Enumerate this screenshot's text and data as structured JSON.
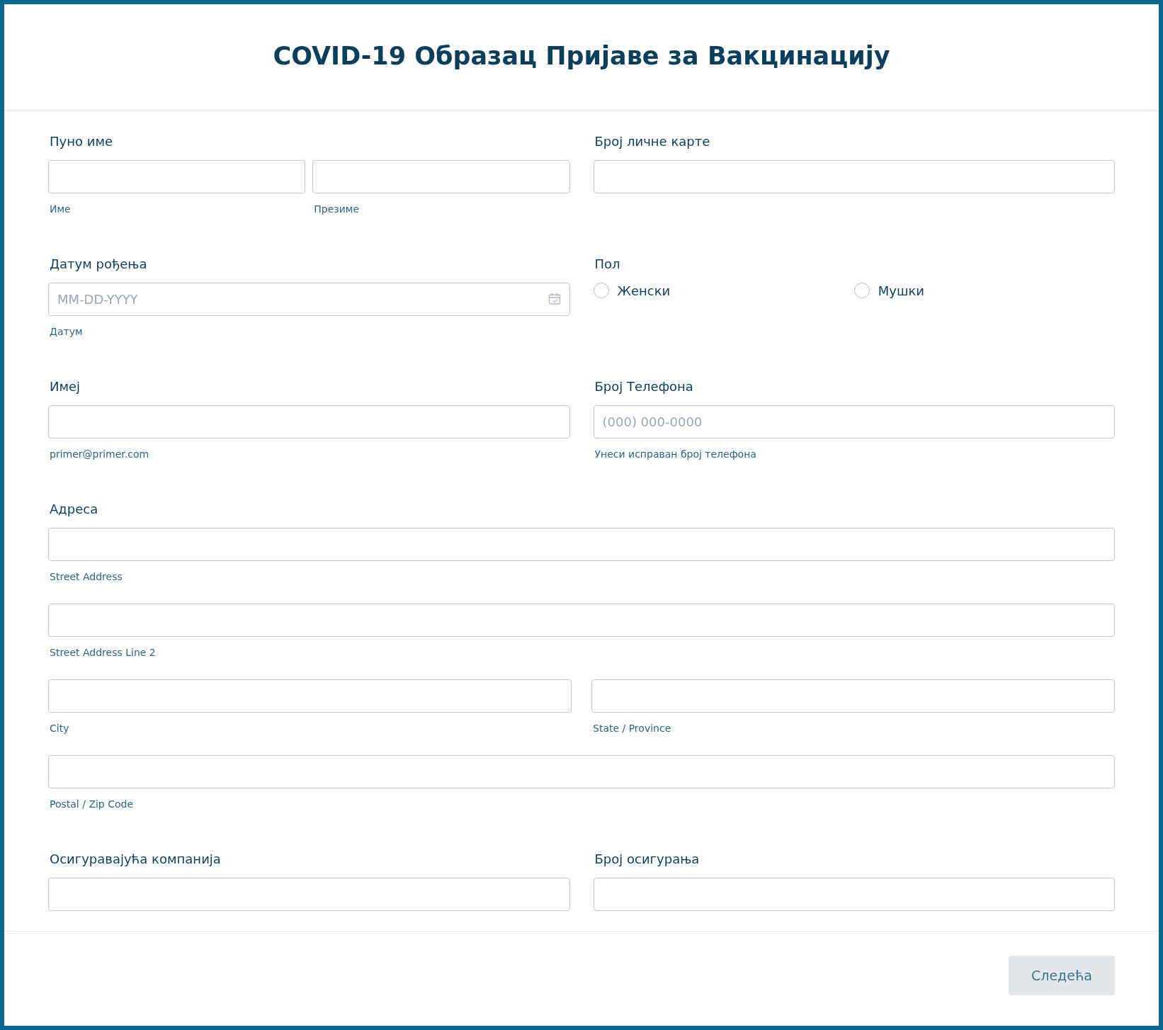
{
  "title": "COVID-19 Образац Пријаве за Вакцинацију",
  "rows": [
    {
      "fields": [
        {
          "kind": "input",
          "label": "Пуно име",
          "lines": [
            [
              {
                "kind": "text",
                "sublabel": "Име"
              },
              {
                "kind": "text",
                "sublabel": "Презиме"
              }
            ]
          ]
        },
        {
          "kind": "input",
          "label": "Број личне карте",
          "lines": [
            [
              {
                "kind": "text"
              }
            ]
          ]
        }
      ]
    },
    {
      "fields": [
        {
          "kind": "input",
          "label": "Датум рођења",
          "lines": [
            [
              {
                "kind": "date",
                "placeholder": "MM-DD-YYYY",
                "sublabel": "Датум"
              }
            ]
          ]
        },
        {
          "kind": "radio",
          "label": "Пол",
          "options": [
            {
              "label": "Женски",
              "selected": false
            },
            {
              "label": "Мушки",
              "selected": false
            }
          ]
        }
      ]
    },
    {
      "fields": [
        {
          "kind": "input",
          "label": "Имеј",
          "lines": [
            [
              {
                "kind": "text",
                "sublabel": "primer@primer.com"
              }
            ]
          ]
        },
        {
          "kind": "input",
          "label": "Број Телефона",
          "lines": [
            [
              {
                "kind": "text",
                "placeholder": "(000) 000-0000",
                "sublabel": "Унеси исправан број телефона"
              }
            ]
          ]
        }
      ]
    },
    {
      "fields": [
        {
          "kind": "input",
          "label": "Адреса",
          "lines": [
            [
              {
                "kind": "text",
                "sublabel": "Street Address"
              }
            ],
            [
              {
                "kind": "text",
                "sublabel": "Street Address Line 2"
              }
            ],
            [
              {
                "kind": "text",
                "sublabel": "City"
              },
              {
                "kind": "text",
                "sublabel": "State / Province"
              }
            ],
            [
              {
                "kind": "text",
                "sublabel": "Postal / Zip Code"
              }
            ]
          ]
        }
      ]
    },
    {
      "fields": [
        {
          "kind": "input",
          "label": "Осигуравајућа компанија",
          "lines": [
            [
              {
                "kind": "text"
              }
            ]
          ]
        },
        {
          "kind": "input",
          "label": "Број осигурања",
          "lines": [
            [
              {
                "kind": "text"
              }
            ]
          ]
        }
      ]
    }
  ],
  "next_button": "Следећа"
}
